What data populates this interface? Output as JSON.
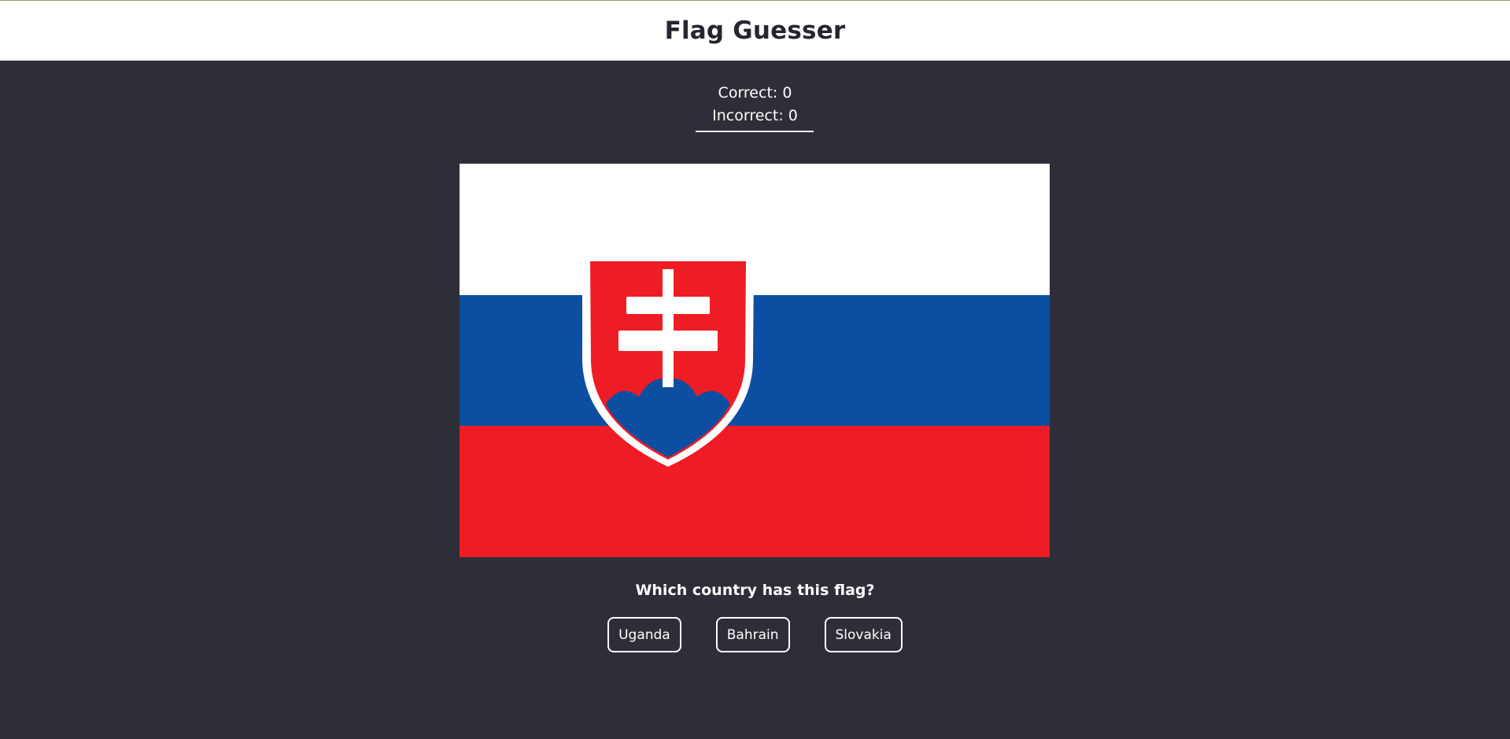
{
  "header": {
    "title": "Flag Guesser"
  },
  "score": {
    "correct_text": "Correct: 0",
    "incorrect_text": "Incorrect: 0"
  },
  "flag": {
    "colors": {
      "white": "#ffffff",
      "blue": "#0b4ea2",
      "red": "#ee1c25"
    }
  },
  "question": {
    "text": "Which country has this flag?"
  },
  "answers": [
    {
      "label": "Uganda"
    },
    {
      "label": "Bahrain"
    },
    {
      "label": "Slovakia"
    }
  ]
}
